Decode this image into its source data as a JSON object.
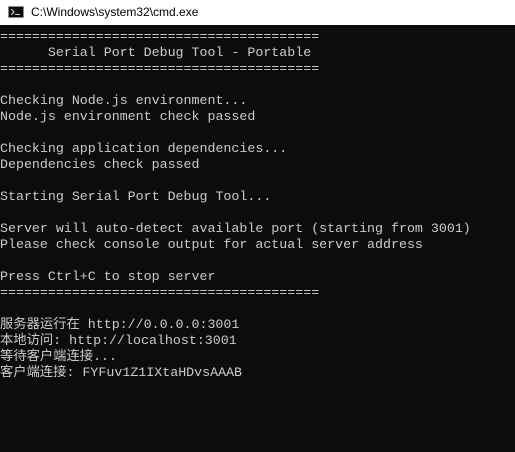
{
  "window": {
    "title": "C:\\Windows\\system32\\cmd.exe",
    "icon": "cmd-icon"
  },
  "console": {
    "lines": [
      "========================================",
      "      Serial Port Debug Tool - Portable",
      "========================================",
      "",
      "Checking Node.js environment...",
      "Node.js environment check passed",
      "",
      "Checking application dependencies...",
      "Dependencies check passed",
      "",
      "Starting Serial Port Debug Tool...",
      "",
      "Server will auto-detect available port (starting from 3001)",
      "Please check console output for actual server address",
      "",
      "Press Ctrl+C to stop server",
      "========================================",
      "",
      "服务器运行在 http://0.0.0.0:3001",
      "本地访问: http://localhost:3001",
      "等待客户端连接...",
      "客户端连接: FYFuv1Z1IXtaHDvsAAAB"
    ]
  },
  "colors": {
    "console_bg": "#0c0c0c",
    "console_fg": "#cccccc",
    "titlebar_bg": "#ffffff"
  }
}
